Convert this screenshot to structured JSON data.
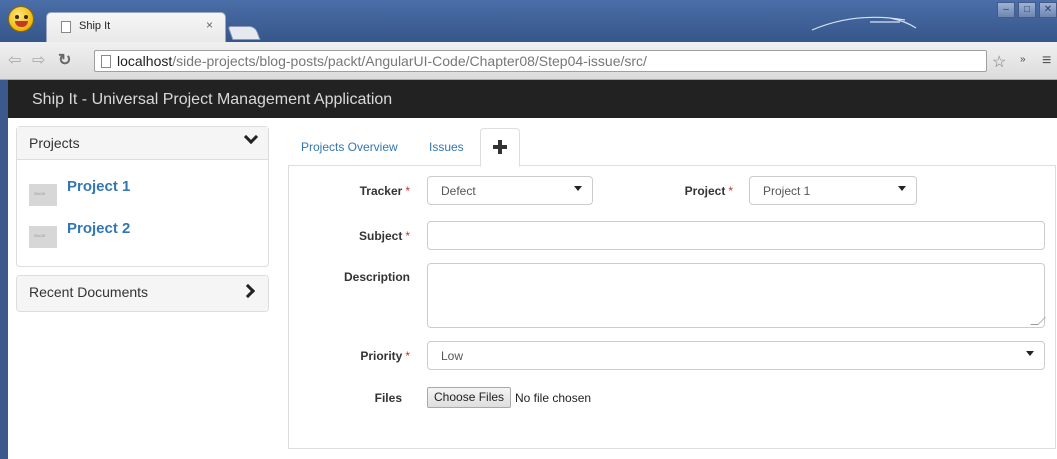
{
  "browser": {
    "tab_title": "Ship It",
    "tab_close": "×",
    "url_host": "localhost",
    "url_path": "/side-projects/blog-posts/packt/AngularUI-Code/Chapter08/Step04-issue/src/",
    "window_buttons": [
      "–",
      "□",
      "✕"
    ]
  },
  "navbar": {
    "brand": "Ship It - Universal Project Management Application"
  },
  "sidebar": {
    "projects_title": "Projects",
    "projects": [
      {
        "name": "Project 1"
      },
      {
        "name": "Project 2"
      }
    ],
    "recent_title": "Recent Documents"
  },
  "tabs": {
    "overview": "Projects Overview",
    "issues": "Issues"
  },
  "form": {
    "tracker_label": "Tracker",
    "tracker_value": "Defect",
    "project_label": "Project",
    "project_value": "Project 1",
    "subject_label": "Subject",
    "subject_value": "",
    "description_label": "Description",
    "description_value": "",
    "priority_label": "Priority",
    "priority_value": "Low",
    "files_label": "Files",
    "files_button": "Choose Files",
    "files_status": "No file chosen",
    "required_mark": "*"
  },
  "colors": {
    "link": "#3277b3",
    "required": "#c9302c",
    "navbar": "#222222"
  }
}
